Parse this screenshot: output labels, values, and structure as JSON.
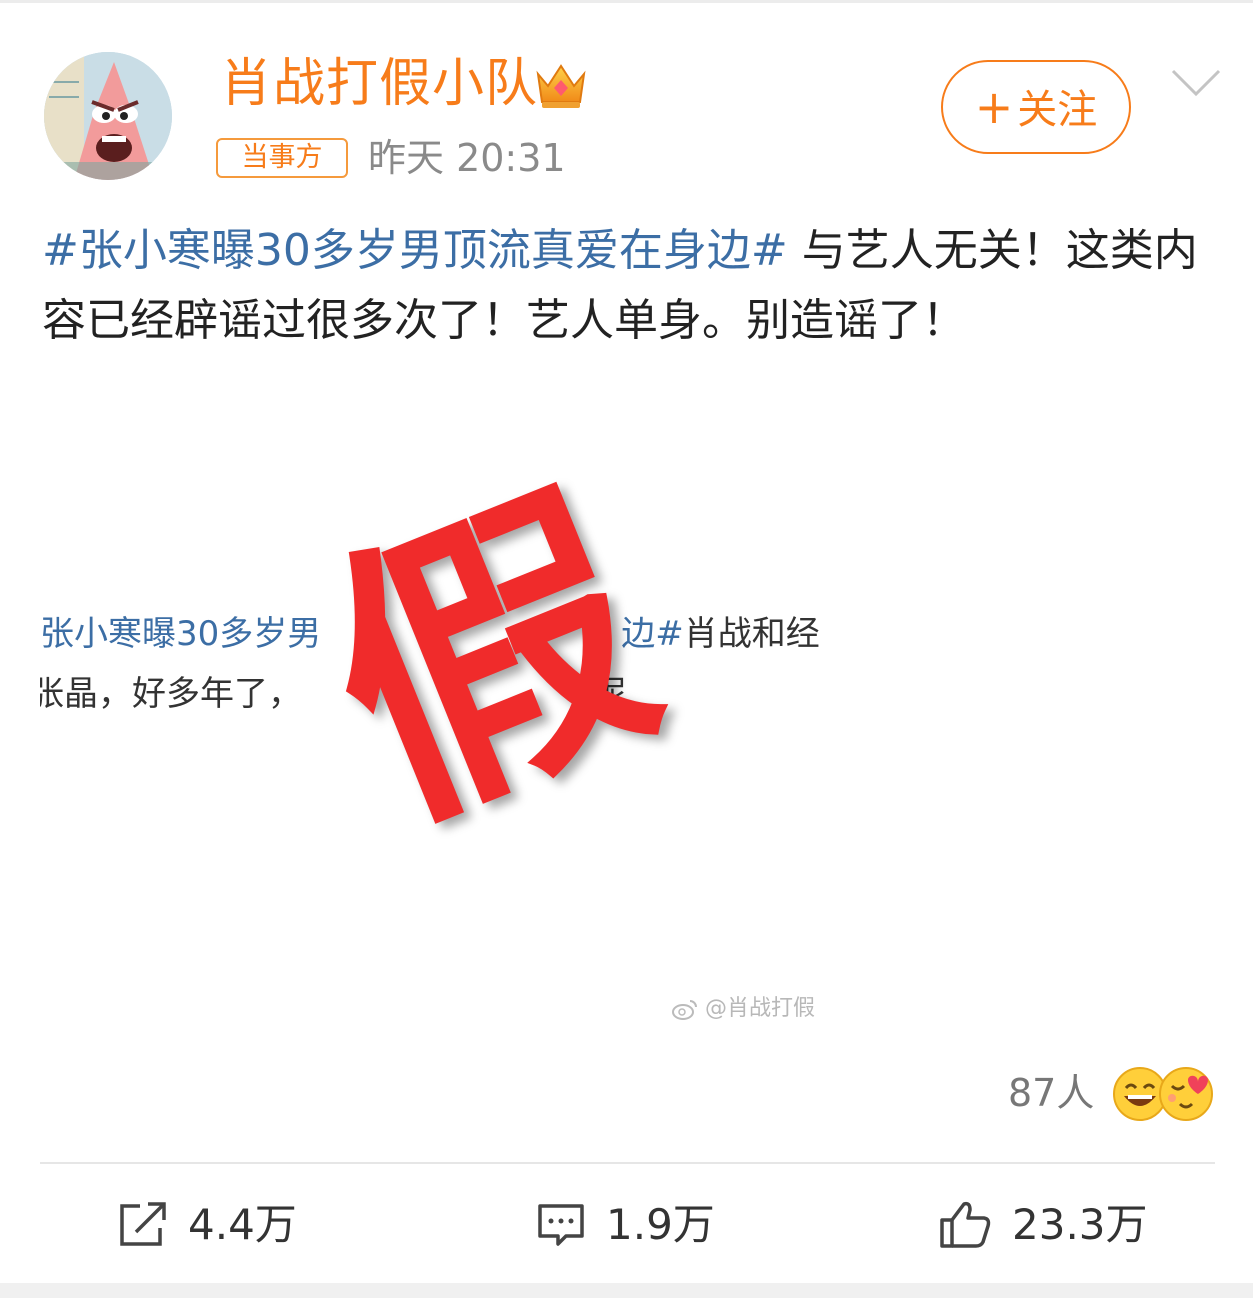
{
  "author": {
    "name": "肖战打假小队",
    "role_badge": "当事方",
    "timestamp": "昨天 20:31"
  },
  "follow_button": {
    "plus": "+",
    "label": "关注"
  },
  "post": {
    "hashtag": "#张小寒曝30多岁男顶流真爱在身边#",
    "body": " 与艺人无关！这类内容已经辟谣过很多次了！艺人单身。别造谣了！"
  },
  "image": {
    "line1_link": "张小寒曝30多岁男",
    "line1_link2": "边#",
    "line1_tail": "肖战和经纪",
    "line2": "张晶，好多年了，",
    "line2_tail": "呢",
    "stamp": "假",
    "watermark": "@肖战打假"
  },
  "reactions": {
    "count": "87人"
  },
  "actions": {
    "share": "4.4万",
    "comment": "1.9万",
    "like": "23.3万"
  },
  "colors": {
    "accent": "#f77c1a",
    "hashtag": "#3c6ea5",
    "stamp": "#f02b2b"
  }
}
